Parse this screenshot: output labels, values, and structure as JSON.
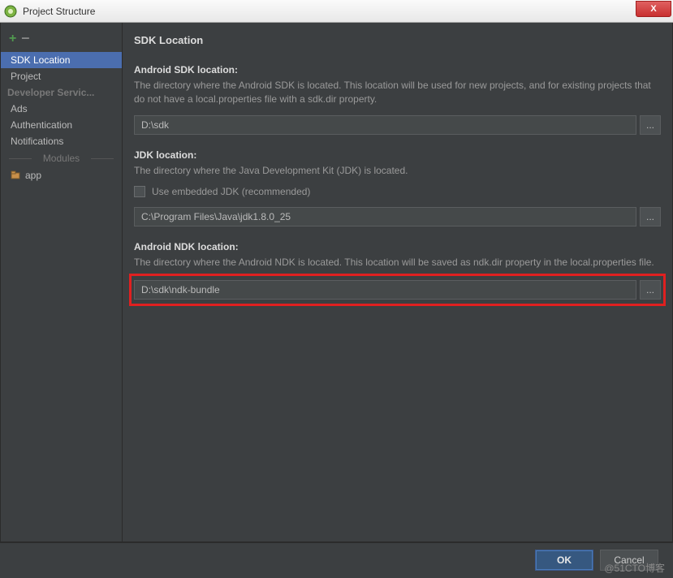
{
  "window": {
    "title": "Project Structure",
    "close_label": "X"
  },
  "sidebar": {
    "items": [
      {
        "label": "SDK Location"
      },
      {
        "label": "Project"
      }
    ],
    "dev_header": "Developer Servic...",
    "dev_items": [
      {
        "label": "Ads"
      },
      {
        "label": "Authentication"
      },
      {
        "label": "Notifications"
      }
    ],
    "modules_header": "Modules",
    "app_label": "app"
  },
  "main": {
    "title": "SDK Location",
    "sdk": {
      "heading": "Android SDK location:",
      "desc": "The directory where the Android SDK is located. This location will be used for new projects, and for existing projects that do not have a local.properties file with a sdk.dir property.",
      "value": "D:\\sdk",
      "browse": "..."
    },
    "jdk": {
      "heading": "JDK location:",
      "desc": "The directory where the Java Development Kit (JDK) is located.",
      "embedded_label": "Use embedded JDK (recommended)",
      "value": "C:\\Program Files\\Java\\jdk1.8.0_25",
      "browse": "..."
    },
    "ndk": {
      "heading": "Android NDK location:",
      "desc": "The directory where the Android NDK is located. This location will be saved as ndk.dir property in the local.properties file.",
      "value": "D:\\sdk\\ndk-bundle",
      "browse": "..."
    }
  },
  "footer": {
    "ok": "OK",
    "cancel": "Cancel"
  },
  "watermark": "@51CTO博客"
}
